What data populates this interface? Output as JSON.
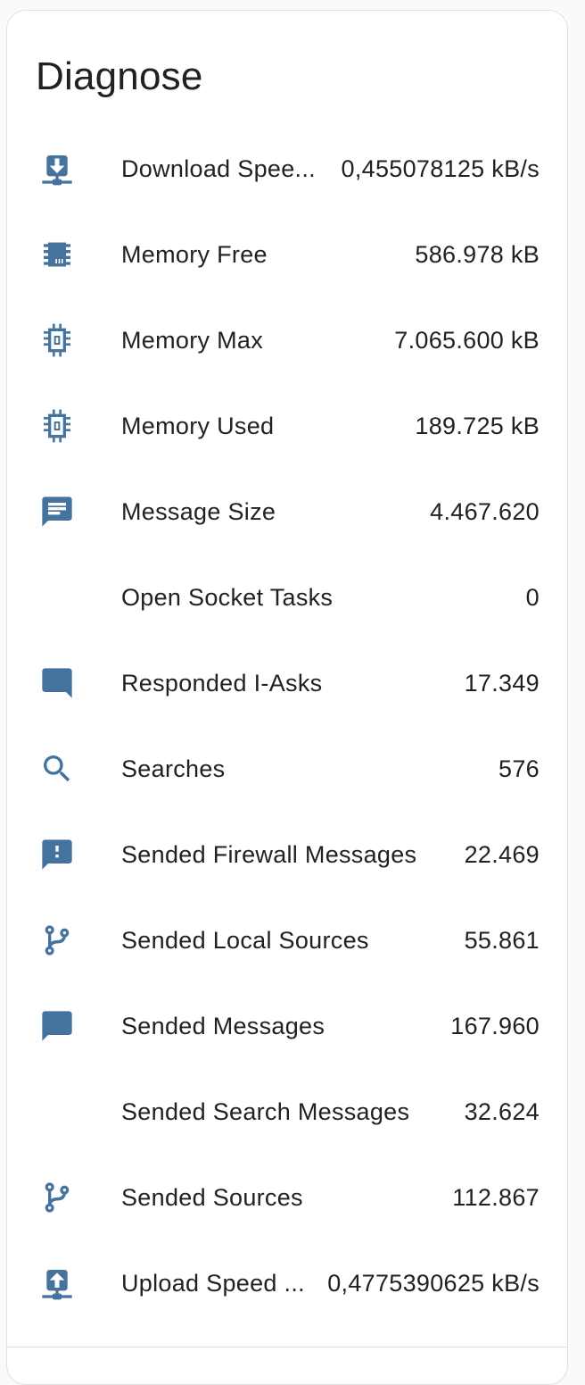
{
  "card": {
    "title": "Diagnose"
  },
  "colors": {
    "icon": "#44739e",
    "text": "#212121",
    "divider": "#e0e0e0"
  },
  "rows": [
    {
      "icon": "download-network-icon",
      "label": "Download Spee...",
      "value": "0,455078125 kB/s"
    },
    {
      "icon": "chip-icon",
      "label": "Memory Free",
      "value": "586.978 kB"
    },
    {
      "icon": "chip-icon",
      "label": "Memory Max",
      "value": "7.065.600 kB"
    },
    {
      "icon": "chip-icon",
      "label": "Memory Used",
      "value": "189.725 kB"
    },
    {
      "icon": "message-text-icon",
      "label": "Message Size",
      "value": "4.467.620"
    },
    {
      "icon": "",
      "label": "Open Socket Tasks",
      "value": "0"
    },
    {
      "icon": "message-reply-icon",
      "label": "Responded I-Asks",
      "value": "17.349"
    },
    {
      "icon": "magnify-icon",
      "label": "Searches",
      "value": "576"
    },
    {
      "icon": "message-alert-icon",
      "label": "Sended Firewall Messages",
      "value": "22.469"
    },
    {
      "icon": "source-branch-icon",
      "label": "Sended Local Sources",
      "value": "55.861"
    },
    {
      "icon": "message-icon",
      "label": "Sended Messages",
      "value": "167.960"
    },
    {
      "icon": "",
      "label": "Sended Search Messages",
      "value": "32.624"
    },
    {
      "icon": "source-branch-icon",
      "label": "Sended Sources",
      "value": "112.867"
    },
    {
      "icon": "upload-network-icon",
      "label": "Upload Speed ...",
      "value": "0,4775390625 kB/s"
    }
  ]
}
